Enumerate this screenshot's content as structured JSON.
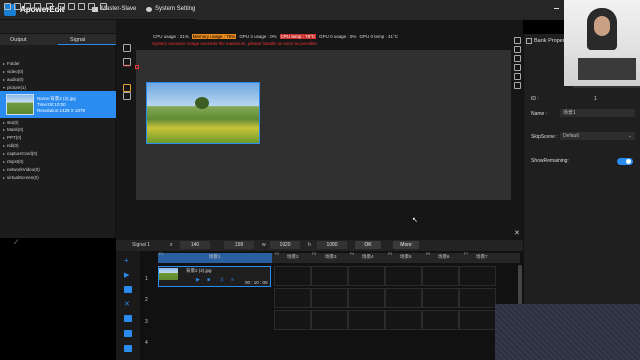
{
  "app": {
    "title": "ApowerEdit"
  },
  "menu": {
    "master_slave": "Master-Slave",
    "system_setting": "System Setting"
  },
  "left_tabs": {
    "output": "Output",
    "signal": "Signal"
  },
  "tree": [
    "Folder",
    "video(0)",
    "audio(0)",
    "picture(1)",
    "stu(0)",
    "Mask(0)",
    "PPT(0)",
    "ndi(0)",
    "captureCard(0)",
    "rtspst(0)",
    "networkVideo(0)",
    "virtualScreen(0)"
  ],
  "selected_item": {
    "name": "Name:背景2 (2).jpg",
    "time": "Time:00:10:00",
    "resolution": "Resolution:1429 X 1079"
  },
  "status": {
    "cpu": "CPU usage : 21%",
    "memory": "Memory usage : 76%",
    "gpu3d": "GPU 3 usage : 0%",
    "cpu_temp": "CPU temp : 78°C",
    "gpu0": "GPU 0 usage : 0%",
    "gpu_temp": "GPU 0 temp : 41°C",
    "warning": "System resource usage exceeds the maximum, please handle as soon as possible"
  },
  "stage": {
    "marker_label": "K00"
  },
  "props": {
    "title": "Bank Property",
    "id_label": "ID :",
    "id_value": "1",
    "name_label": "Name :",
    "name_value": "场景1",
    "skip_label": "SkipScene :",
    "skip_value": "Default",
    "show_remaining": "ShowRemaining:",
    "toggle": "ON"
  },
  "signal_bar": {
    "signal": "Signal 1",
    "x_label": "x",
    "x": "140",
    "y_label": "y",
    "y": "158",
    "w_label": "w",
    "w": "1920",
    "h_label": "h",
    "h": "1080",
    "ok": "OK",
    "more": "More"
  },
  "timeline": {
    "columns": [
      "场景1",
      "场景2",
      "场景3",
      "场景4",
      "场景5",
      "场景6",
      "场景7"
    ],
    "col_ids": [
      "F1",
      "F2",
      "F3",
      "F4",
      "F5",
      "F6",
      "F7"
    ],
    "rows": [
      "1",
      "2",
      "3",
      "4"
    ],
    "clip": {
      "name": "背景2 (2).jpg",
      "time": "00 : 10 : 00"
    }
  }
}
